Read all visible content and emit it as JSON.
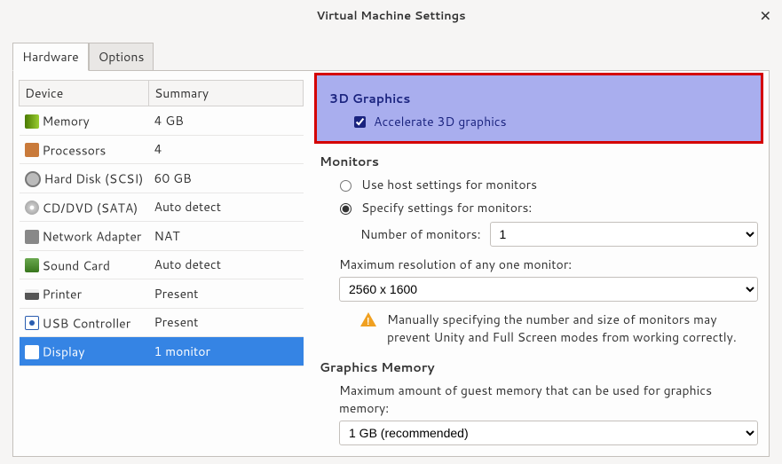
{
  "window": {
    "title": "Virtual Machine Settings"
  },
  "tabs": {
    "hardware": "Hardware",
    "options": "Options"
  },
  "table": {
    "col_device": "Device",
    "col_summary": "Summary"
  },
  "devices": [
    {
      "name": "Memory",
      "summary": "4 GB"
    },
    {
      "name": "Processors",
      "summary": "4"
    },
    {
      "name": "Hard Disk (SCSI)",
      "summary": "60 GB"
    },
    {
      "name": "CD/DVD (SATA)",
      "summary": "Auto detect"
    },
    {
      "name": "Network Adapter",
      "summary": "NAT"
    },
    {
      "name": "Sound Card",
      "summary": "Auto detect"
    },
    {
      "name": "Printer",
      "summary": "Present"
    },
    {
      "name": "USB Controller",
      "summary": "Present"
    },
    {
      "name": "Display",
      "summary": "1 monitor"
    }
  ],
  "s3d": {
    "title": "3D Graphics",
    "label": "Accelerate 3D graphics"
  },
  "mon": {
    "title": "Monitors",
    "use_host": "Use host settings for monitors",
    "specify": "Specify settings for monitors:",
    "num_label": "Number of monitors:",
    "num_value": "1",
    "maxres_label": "Maximum resolution of any one monitor:",
    "maxres_value": "2560 x 1600",
    "warn1": "Manually specifying the number and size of monitors may",
    "warn2": "prevent Unity and Full Screen modes from working correctly."
  },
  "gmem": {
    "title": "Graphics Memory",
    "label": "Maximum amount of guest memory that can be used for graphics memory:",
    "value": "1 GB (recommended)"
  }
}
